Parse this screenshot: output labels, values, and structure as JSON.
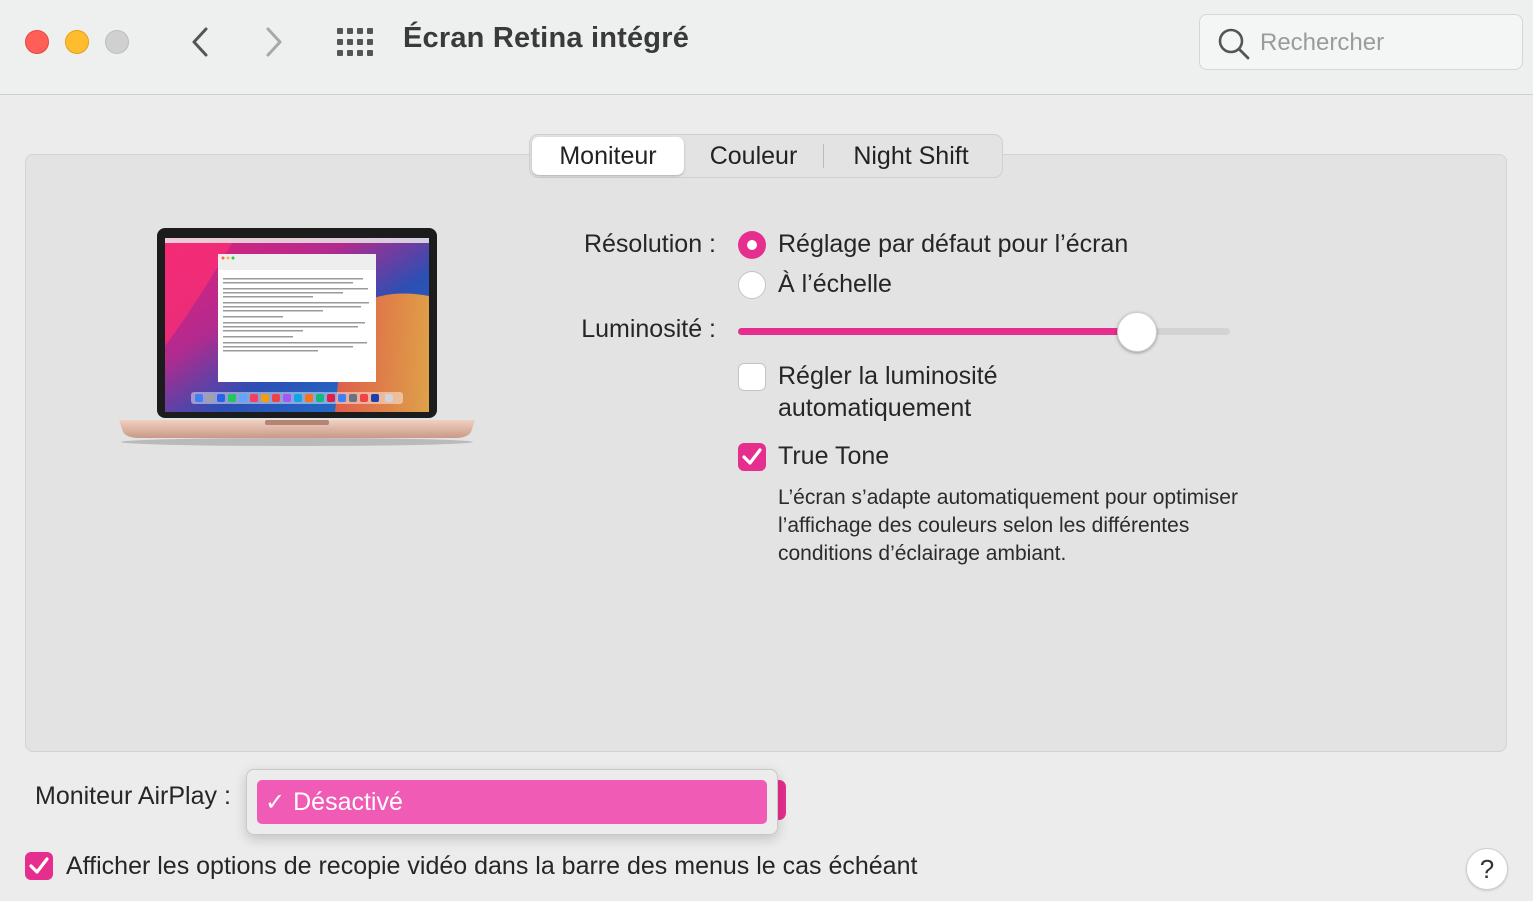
{
  "window": {
    "title": "Écran Retina intégré"
  },
  "search": {
    "placeholder": "Rechercher"
  },
  "tabs": [
    {
      "label": "Moniteur",
      "active": true
    },
    {
      "label": "Couleur",
      "active": false
    },
    {
      "label": "Night Shift",
      "active": false
    }
  ],
  "display": {
    "resolution_label": "Résolution :",
    "resolution_options": [
      {
        "label": "Réglage par défaut pour l’écran",
        "selected": true
      },
      {
        "label": "À l’échelle",
        "selected": false
      }
    ],
    "brightness_label": "Luminosité :",
    "brightness_value": 0.81,
    "auto_brightness": {
      "line1": "Régler la luminosité",
      "line2": "automatiquement",
      "checked": false
    },
    "true_tone": {
      "label": "True Tone",
      "checked": true,
      "description": "L’écran s’adapte automatiquement pour optimiser l’affichage des couleurs selon les différentes conditions d’éclairage ambiant."
    }
  },
  "airplay": {
    "label": "Moniteur AirPlay :",
    "selected_option": "Désactivé"
  },
  "mirroring": {
    "label": "Afficher les options de recopie vidéo dans la barre des menus le cas échéant",
    "checked": true
  },
  "help": {
    "label": "?"
  },
  "colors": {
    "accent": "#e62e8e",
    "highlight": "#f05bb5"
  }
}
